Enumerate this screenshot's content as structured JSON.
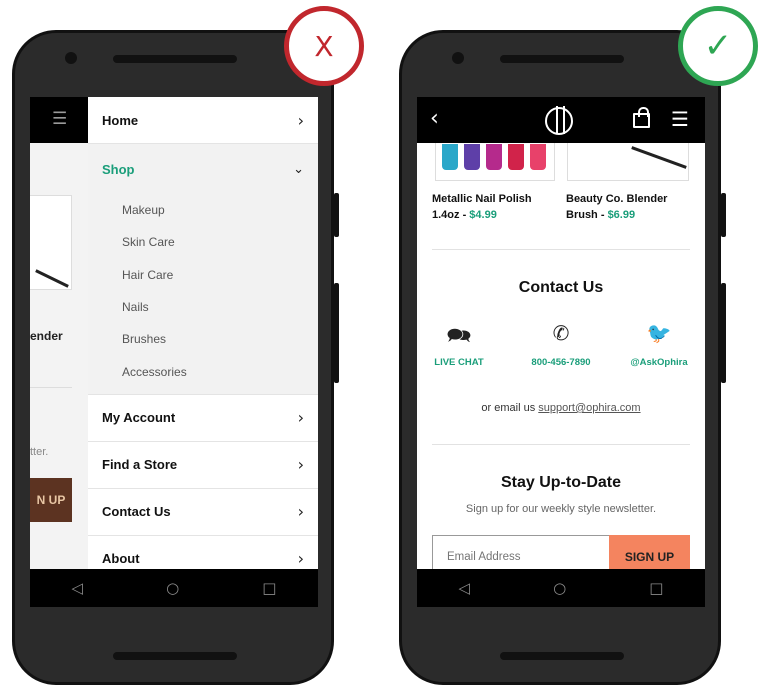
{
  "badges": {
    "bad": "X",
    "good": "✓"
  },
  "left_phone": {
    "background_site": {
      "product_fragment": "ender",
      "newsletter_fragment": "tter.",
      "button_fragment": "N UP"
    },
    "drawer": {
      "home": "Home",
      "shop": {
        "label": "Shop",
        "items": [
          "Makeup",
          "Skin Care",
          "Hair Care",
          "Nails",
          "Brushes",
          "Accessories"
        ]
      },
      "rows": [
        "My Account",
        "Find a Store",
        "Contact Us",
        "About"
      ]
    },
    "nav_icons": [
      "back-triangle-icon",
      "home-circle-icon",
      "recents-square-icon"
    ]
  },
  "right_phone": {
    "products": [
      {
        "name": "Metallic Nail Polish 1.4oz - ",
        "price": "$4.99"
      },
      {
        "name": "Beauty Co. Blender Brush - ",
        "price": "$6.99"
      }
    ],
    "contact": {
      "title": "Contact Us",
      "live_chat": "LIVE CHAT",
      "phone": "800-456-7890",
      "twitter": "@AskOphira",
      "email_prefix": "or email us ",
      "email": "support@ophira.com"
    },
    "newsletter": {
      "title": "Stay Up-to-Date",
      "subtitle": "Sign up for our weekly style newsletter.",
      "placeholder": "Email Address",
      "button": "SIGN UP"
    }
  },
  "colors": {
    "accent_green": "#1a9e7a",
    "signup_orange": "#f4845f",
    "bad_red": "#c1272d",
    "good_green": "#2ea653"
  }
}
